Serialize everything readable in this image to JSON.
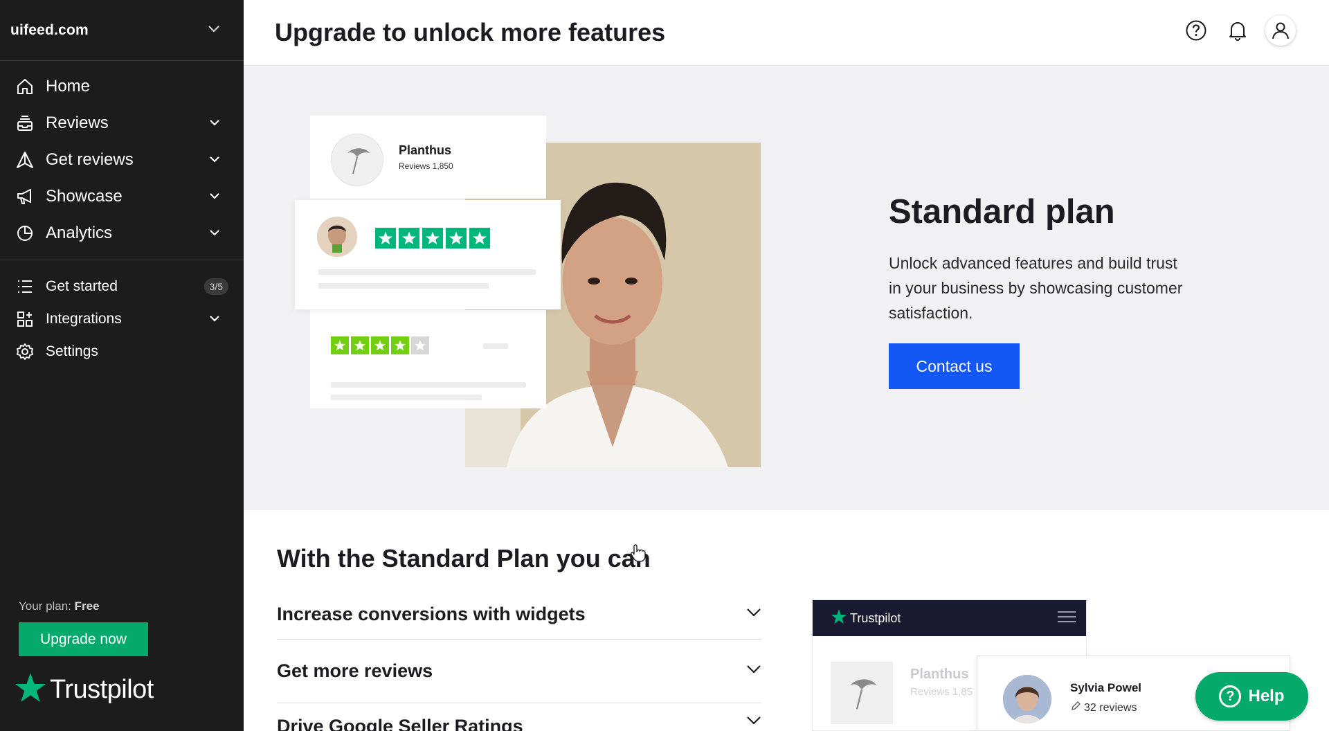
{
  "sidebar": {
    "domain": "uifeed.com",
    "nav_items": [
      {
        "label": "Home",
        "icon": "home-icon"
      },
      {
        "label": "Reviews",
        "icon": "inbox-icon"
      },
      {
        "label": "Get reviews",
        "icon": "send-icon"
      },
      {
        "label": "Showcase",
        "icon": "megaphone-icon"
      },
      {
        "label": "Analytics",
        "icon": "pie-chart-icon"
      }
    ],
    "secondary_items": [
      {
        "label": "Get started",
        "icon": "list-icon",
        "badge": "3/5"
      },
      {
        "label": "Integrations",
        "icon": "grid-icon"
      },
      {
        "label": "Settings",
        "icon": "gear-icon"
      }
    ],
    "plan_label": "Your plan:",
    "plan_value": "Free",
    "upgrade_label": "Upgrade now",
    "brand": "Trustpilot"
  },
  "header": {
    "title": "Upgrade to unlock more features"
  },
  "hero": {
    "mock_card": {
      "name": "Planthus",
      "reviews": "Reviews 1,850"
    },
    "plan_title": "Standard plan",
    "plan_description": "Unlock advanced features and build trust in your business by showcasing customer satisfaction.",
    "cta_label": "Contact us"
  },
  "features": {
    "title": "With the Standard Plan you can",
    "items": [
      "Increase conversions with widgets",
      "Get more reviews",
      "Drive Google Seller Ratings"
    ]
  },
  "preview": {
    "brand": "Trustpilot",
    "company": "Planthus",
    "company_sub": "Reviews 1,85",
    "reviewer_name": "Sylvia Powel",
    "reviewer_count": "32 reviews"
  },
  "help": {
    "label": "Help"
  },
  "colors": {
    "sidebar_bg": "#1c1c1c",
    "accent_green": "#04a96b",
    "star_green": "#00b67a",
    "cta_blue": "#1358f5",
    "hero_bg": "#f1f1f3"
  }
}
